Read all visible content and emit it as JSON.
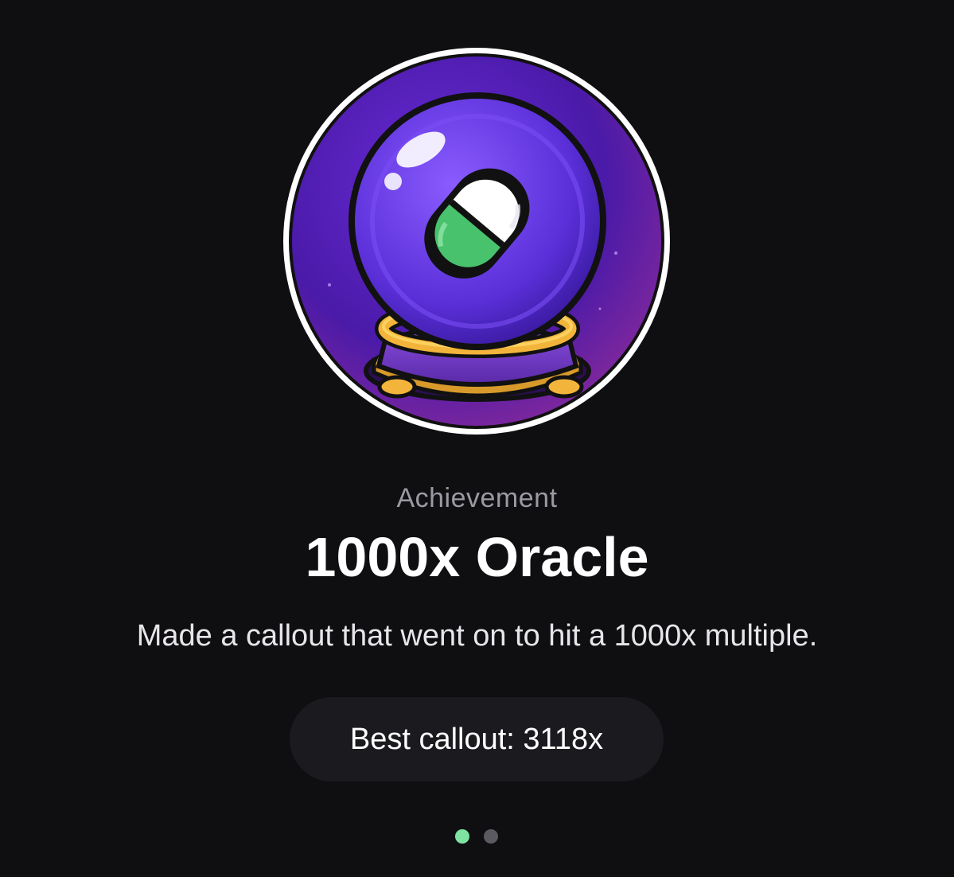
{
  "badge": {
    "icon": "crystal-ball-pill-icon",
    "colors": {
      "ring": "#ffffff",
      "background": "#5a1fb8",
      "orb": "#6b3df0",
      "pill_top": "#ffffff",
      "pill_bottom": "#46c46b",
      "stand": "#7a3fd0",
      "gold": "#f2b43a"
    }
  },
  "achievement": {
    "category": "Achievement",
    "title": "1000x Oracle",
    "description": "Made a callout that went on to hit a 1000x multiple.",
    "stat": "Best callout: 3118x"
  },
  "pager": {
    "count": 2,
    "active_index": 0,
    "active_color": "#7ee2a0",
    "inactive_color": "#5a5a60"
  }
}
